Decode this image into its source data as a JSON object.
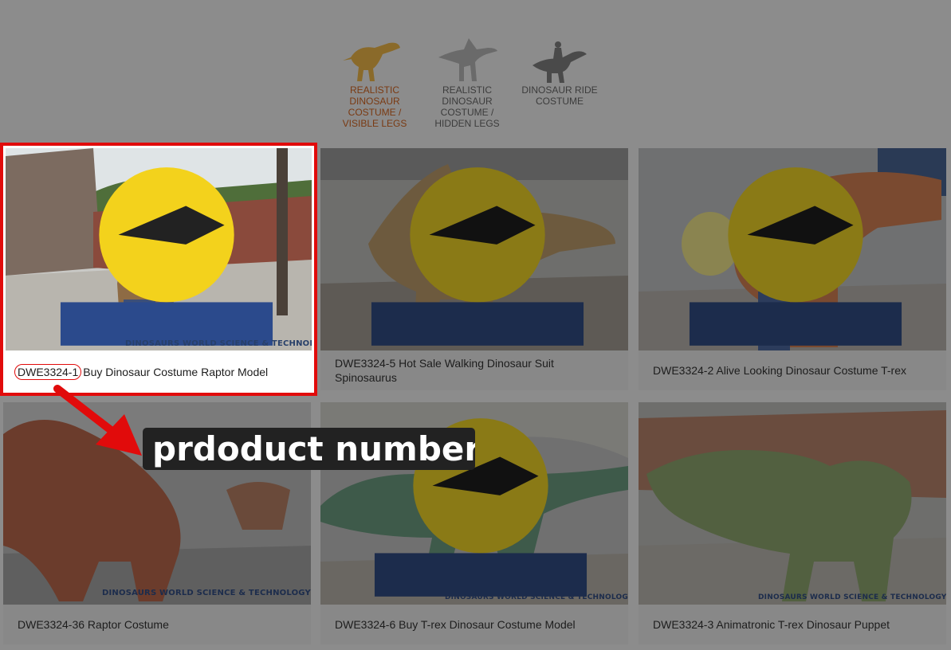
{
  "categories": [
    {
      "label": "REALISTIC DINOSAUR COSTUME / VISIBLE LEGS",
      "active": true,
      "icon": "raptor-costume-icon"
    },
    {
      "label": "REALISTIC DINOSAUR COSTUME / HIDDEN LEGS",
      "active": false,
      "icon": "spinosaurus-costume-icon"
    },
    {
      "label": "DINOSAUR RIDE COSTUME",
      "active": false,
      "icon": "dinosaur-ride-icon"
    }
  ],
  "products": [
    {
      "code": "DWE3324-1",
      "title": "Buy Dinosaur Costume Raptor Model"
    },
    {
      "title": "DWE3324-5 Hot Sale Walking Dinosaur Suit Spinosaurus"
    },
    {
      "title": "DWE3324-2 Alive Looking Dinosaur Costume T-rex"
    },
    {
      "title": "DWE3324-36 Raptor Costume"
    },
    {
      "title": "DWE3324-6 Buy T-rex Dinosaur Costume Model"
    },
    {
      "title": "DWE3324-3 Animatronic T-rex Dinosaur Puppet"
    }
  ],
  "watermark": "DINOSAURS WORLD SCIENCE & TECHNOLOGY CO.,LTD.",
  "logo_text": "DINOSAURS",
  "annotation": {
    "text": "prdoduct number",
    "color": "#e10b0b"
  }
}
